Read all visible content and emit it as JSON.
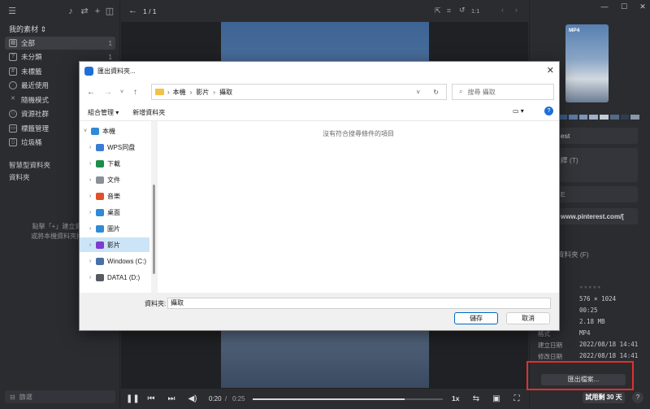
{
  "sidebar": {
    "library_title": "我的素材",
    "items": [
      {
        "label": "全部",
        "count": "1",
        "icon": "grid-icon",
        "active": true
      },
      {
        "label": "未分類",
        "count": "1",
        "icon": "unsorted-icon"
      },
      {
        "label": "未標籤",
        "count": "1",
        "icon": "untagged-icon"
      },
      {
        "label": "最近使用",
        "count": "",
        "icon": "clock-icon"
      },
      {
        "label": "隨機模式",
        "count": "",
        "icon": "shuffle-icon"
      },
      {
        "label": "資源社群",
        "count": "",
        "icon": "community-icon"
      },
      {
        "label": "標籤管理",
        "count": "",
        "icon": "tag-icon"
      },
      {
        "label": "垃圾桶",
        "count": "",
        "icon": "trash-icon"
      }
    ],
    "smart_folders_label": "智慧型資料夾",
    "folders_label": "資料夾",
    "hint_line1": "點擊「+」建立資",
    "hint_line2": "或將本機資料夾拖",
    "filter_placeholder": "篩選"
  },
  "viewer": {
    "page_indicator": "1 / 1",
    "current_time": "0:20",
    "separator": "/",
    "total_time": "0:25",
    "speed": "1x",
    "zoom": "1:1",
    "progress": 0.8
  },
  "right_panel": {
    "thumb_badge": "MP4",
    "swatches": [
      "#3b5c86",
      "#5a79a4",
      "#7c96b8",
      "#9fb1c9",
      "#c2ccd6",
      "#546a84",
      "#2e3d52",
      "#8a98a8"
    ],
    "name_tail": "est",
    "note_tail": "繹 (T)",
    "tag_tail": "E",
    "url_tail": "www.pinterest.com/[",
    "folder_tail": "資料夾 (F)",
    "meta": [
      {
        "key": "",
        "value": "★★★★★"
      },
      {
        "key": "",
        "value": "576 × 1024"
      },
      {
        "key": "",
        "value": "00:25"
      },
      {
        "key": "",
        "value": "2.18 MB"
      },
      {
        "key": "格式",
        "value": "MP4"
      },
      {
        "key": "建立日期",
        "value": "2022/08/18 14:41"
      },
      {
        "key": "修改日期",
        "value": "2022/08/18 14:41"
      }
    ],
    "export_button": "匯出檔案...",
    "trial_badge": "試用剩 30 天",
    "help": "?"
  },
  "dialog": {
    "title": "匯出資料夾...",
    "path": [
      "本機",
      "影片",
      "攝取"
    ],
    "search_placeholder": "搜尋 攝取",
    "organize_label": "組合管理",
    "new_folder_label": "新增資料夾",
    "empty_message": "沒有符合搜尋條件的項目",
    "tree": [
      {
        "label": "本機",
        "expanded": true,
        "color": "#2f8ad8"
      },
      {
        "label": "WPS同盘",
        "color": "#3a7bd5"
      },
      {
        "label": "下載",
        "color": "#1b8e4a"
      },
      {
        "label": "文件",
        "color": "#8a8f98"
      },
      {
        "label": "音樂",
        "color": "#e0512b"
      },
      {
        "label": "桌面",
        "color": "#2f8ad8"
      },
      {
        "label": "圖片",
        "color": "#2f8ad8"
      },
      {
        "label": "影片",
        "color": "#7d3ccf",
        "selected": true
      },
      {
        "label": "Windows (C:)",
        "color": "#4a6fa5"
      },
      {
        "label": "DATA1 (D:)",
        "color": "#555a60"
      }
    ],
    "folder_label": "資料夾:",
    "folder_value": "攝取",
    "save_button": "儲存",
    "cancel_button": "取消"
  }
}
